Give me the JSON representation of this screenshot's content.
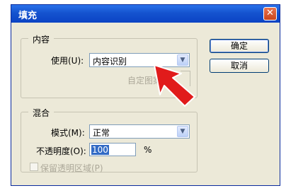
{
  "dialog": {
    "title": "填充",
    "close_glyph": "✕"
  },
  "content_group": {
    "legend": "内容",
    "use_label": "使用(U):",
    "use_value": "内容识别",
    "custom_pattern_label": "自定图案:"
  },
  "blend_group": {
    "legend": "混合",
    "mode_label": "模式(M):",
    "mode_value": "正常",
    "opacity_label": "不透明度(O):",
    "opacity_value": "100",
    "opacity_unit": "%",
    "preserve_label": "保留透明区域(P)"
  },
  "buttons": {
    "ok": "确定",
    "cancel": "取消"
  },
  "icons": {
    "dropdown": "chevron-down-icon",
    "annotation": "red-arrow-icon"
  },
  "colors": {
    "titlebar": "#0b43c4",
    "arrow": "#e11b1b"
  }
}
